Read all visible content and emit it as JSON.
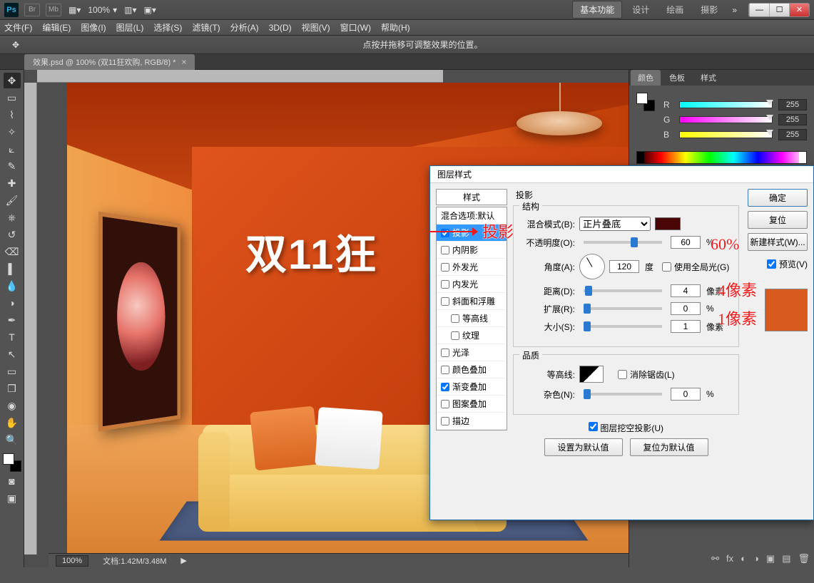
{
  "titlebar": {
    "zoom": "100%",
    "workspaces": {
      "basic": "基本功能",
      "design": "设计",
      "paint": "绘画",
      "photo": "摄影"
    }
  },
  "menu": {
    "file": "文件(F)",
    "edit": "编辑(E)",
    "image": "图像(I)",
    "layer": "图层(L)",
    "select": "选择(S)",
    "filter": "滤镜(T)",
    "analyze": "分析(A)",
    "3d": "3D(D)",
    "view": "视图(V)",
    "window": "窗口(W)",
    "help": "帮助(H)"
  },
  "optbar": {
    "hint": "点按并拖移可调整效果的位置。"
  },
  "doc": {
    "tab": "效果.psd @ 100% (双11狂欢购, RGB/8) *"
  },
  "artwork": {
    "headline": "双11狂"
  },
  "colorpanel": {
    "tabs": {
      "color": "颜色",
      "swatches": "色板",
      "styles": "样式"
    },
    "R": "R",
    "G": "G",
    "B": "B",
    "rv": "255",
    "gv": "255",
    "bv": "255"
  },
  "status": {
    "zoom": "100%",
    "docinfo": "文档:1.42M/3.48M"
  },
  "dialog": {
    "title": "图层样式",
    "left": {
      "header": "样式",
      "items": [
        {
          "label": "混合选项:默认",
          "selected": false
        },
        {
          "label": "投影",
          "selected": true,
          "checked": true
        },
        {
          "label": "内阴影",
          "checked": false
        },
        {
          "label": "外发光",
          "checked": false
        },
        {
          "label": "内发光",
          "checked": false
        },
        {
          "label": "斜面和浮雕",
          "checked": false
        },
        {
          "label": "等高线",
          "checked": false,
          "indent": true
        },
        {
          "label": "纹理",
          "checked": false,
          "indent": true
        },
        {
          "label": "光泽",
          "checked": false
        },
        {
          "label": "颜色叠加",
          "checked": false
        },
        {
          "label": "渐变叠加",
          "checked": true
        },
        {
          "label": "图案叠加",
          "checked": false
        },
        {
          "label": "描边",
          "checked": false
        }
      ]
    },
    "section_title": "投影",
    "structure_title": "结构",
    "blend_label": "混合模式(B):",
    "blend_value": "正片叠底",
    "opacity_label": "不透明度(O):",
    "opacity_value": "60",
    "opacity_unit": "%",
    "angle_label": "角度(A):",
    "angle_value": "120",
    "angle_unit": "度",
    "global": "使用全局光(G)",
    "distance_label": "距离(D):",
    "distance_value": "4",
    "distance_unit": "像素",
    "spread_label": "扩展(R):",
    "spread_value": "0",
    "spread_unit": "%",
    "size_label": "大小(S):",
    "size_value": "1",
    "size_unit": "像素",
    "quality_title": "品质",
    "contour_label": "等高线:",
    "antialias": "消除锯齿(L)",
    "noise_label": "杂色(N):",
    "noise_value": "0",
    "noise_unit": "%",
    "knockout": "图层挖空投影(U)",
    "reset_default": "设置为默认值",
    "restore_default": "复位为默认值",
    "buttons": {
      "ok": "确定",
      "cancel": "复位",
      "newstyle": "新建样式(W)...",
      "preview": "预览(V)"
    }
  },
  "annotations": {
    "shadow": "投影",
    "pct": "60%",
    "dist": "4像素",
    "size": "1像素"
  }
}
